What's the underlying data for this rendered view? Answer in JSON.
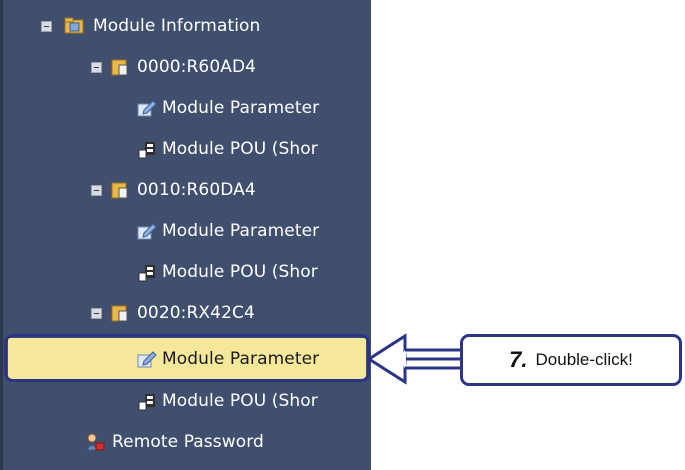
{
  "tree": {
    "items": [
      {
        "label": "Module Information",
        "icon": "folder-module-icon",
        "expander": "collapse",
        "level": 0
      },
      {
        "label": "0000:R60AD4",
        "icon": "module-unit-icon",
        "expander": "collapse",
        "level": 1
      },
      {
        "label": "Module Parameter",
        "icon": "parameter-icon",
        "level": 2
      },
      {
        "label": "Module POU (Shor",
        "icon": "pou-icon",
        "level": 2
      },
      {
        "label": "0010:R60DA4",
        "icon": "module-unit-icon",
        "expander": "collapse",
        "level": 1
      },
      {
        "label": "Module Parameter",
        "icon": "parameter-icon",
        "level": 2
      },
      {
        "label": "Module POU (Shor",
        "icon": "pou-icon",
        "level": 2
      },
      {
        "label": "0020:RX42C4",
        "icon": "module-unit-icon",
        "expander": "collapse",
        "level": 1
      },
      {
        "label": "Module Parameter",
        "icon": "parameter-icon",
        "level": 2,
        "selected": true
      },
      {
        "label": "Module POU (Shor",
        "icon": "pou-icon",
        "level": 2
      },
      {
        "label": "Remote Password",
        "icon": "remote-password-icon",
        "level": 1
      }
    ]
  },
  "callout": {
    "step": "7.",
    "message": "Double-click!"
  },
  "colors": {
    "panel_bg": "#3f4f6d",
    "selection": "#f5e89a",
    "callout_border": "#2b3486"
  }
}
